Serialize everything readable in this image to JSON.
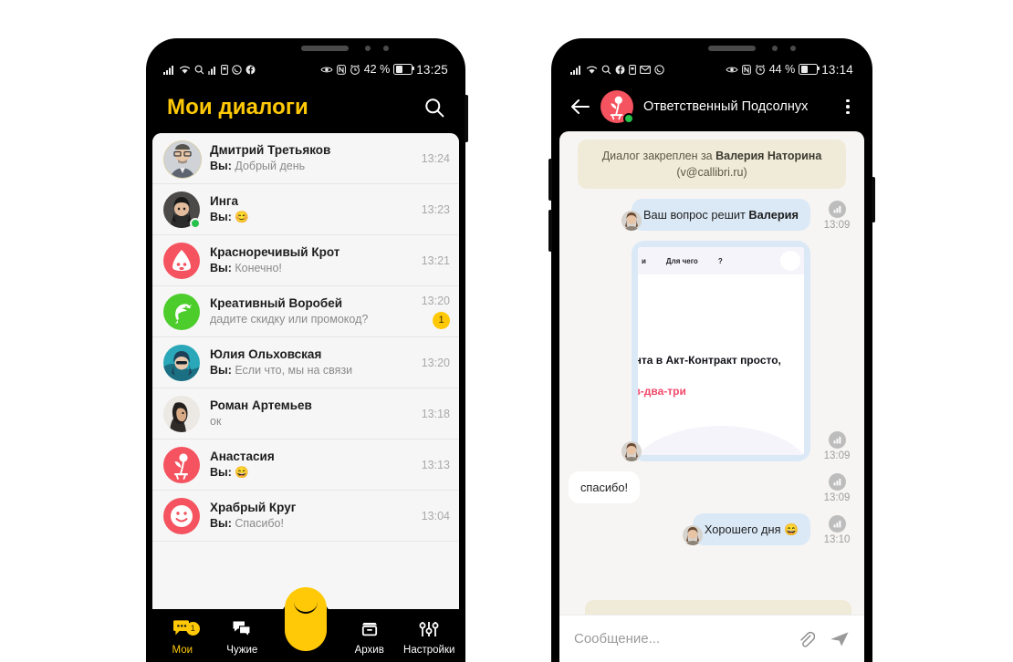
{
  "theme": {
    "accent_yellow": "#FFC907",
    "avatar_red": "#F4535F",
    "avatar_green": "#4CCD2B",
    "online_green": "#27C24C",
    "bubble_out": "#DBE9F7",
    "notice_bg": "#F0EBD8",
    "chat_bg": "#F6F5F3",
    "list_bg": "#F6F6F6"
  },
  "left_phone": {
    "status_bar": {
      "icons_left": [
        "signal-icon",
        "wifi-icon",
        "search-icon",
        "signal2-icon",
        "sim-icon",
        "whatsapp-icon",
        "facebook-icon"
      ],
      "icons_right": [
        "eye-icon",
        "nfc-icon",
        "alarm-icon"
      ],
      "battery_percent": "42 %",
      "time": "13:25"
    },
    "header": {
      "title": "Мои диалоги",
      "search_icon": "search-icon"
    },
    "dialogs": [
      {
        "name": "Дмитрий Третьяков",
        "prefix": "Вы:",
        "preview": "Добрый день",
        "time": "13:24",
        "avatar": "photo-man-glasses",
        "online": false,
        "unread": null
      },
      {
        "name": "Инга",
        "prefix": "Вы:",
        "preview": "😊",
        "time": "13:23",
        "avatar": "photo-woman-dark",
        "online": true,
        "unread": null
      },
      {
        "name": "Красноречивый Крот",
        "prefix": "Вы:",
        "preview": "Конечно!",
        "time": "13:21",
        "avatar": "mole-icon",
        "online": false,
        "unread": null
      },
      {
        "name": "Креативный Воробей",
        "prefix": "",
        "preview": "дадите скидку или промокод?",
        "time": "13:20",
        "avatar": "sparrow-icon",
        "online": false,
        "unread": "1"
      },
      {
        "name": "Юлия Ольховская",
        "prefix": "Вы:",
        "preview": "Если что, мы на связи",
        "time": "13:20",
        "avatar": "photo-woman-teal",
        "online": false,
        "unread": null
      },
      {
        "name": "Роман Артемьев",
        "prefix": "",
        "preview": "ок",
        "time": "13:18",
        "avatar": "photo-man-beard",
        "online": false,
        "unread": null
      },
      {
        "name": "Анастасия",
        "prefix": "Вы:",
        "preview": "😄",
        "time": "13:13",
        "avatar": "sunflower-icon",
        "online": false,
        "unread": null
      },
      {
        "name": "Храбрый Круг",
        "prefix": "Вы:",
        "preview": "Спасибо!",
        "time": "13:04",
        "avatar": "smiley-icon",
        "online": false,
        "unread": null
      }
    ],
    "bottom_nav": [
      {
        "label": "Мои",
        "icon": "chat-bubble-dots-icon",
        "active": true,
        "badge": "1"
      },
      {
        "label": "Чужие",
        "icon": "chat-bubbles-icon",
        "active": false,
        "badge": null
      },
      {
        "label": "Архив",
        "icon": "archive-box-icon",
        "active": false,
        "badge": null
      },
      {
        "label": "Настройки",
        "icon": "sliders-icon",
        "active": false,
        "badge": null
      }
    ],
    "fab": {
      "icon": "smile-capsule-icon"
    }
  },
  "right_phone": {
    "status_bar": {
      "icons_left": [
        "signal-icon",
        "wifi-icon",
        "search-icon",
        "facebook-icon",
        "sim-icon",
        "mail-icon",
        "whatsapp-icon"
      ],
      "icons_right": [
        "eye-icon",
        "nfc-icon",
        "alarm-icon"
      ],
      "battery_percent": "44 %",
      "time": "13:14"
    },
    "header": {
      "back_icon": "arrow-left-icon",
      "avatar": "sunflower-icon",
      "online": true,
      "title": "Ответственный Подсолнух",
      "menu_icon": "kebab-menu-icon"
    },
    "notice": {
      "text_before": "Диалог закреплен за ",
      "assignee": "Валерия Наторина",
      "text_after": "(v@callibri.ru)"
    },
    "messages": [
      {
        "type": "text",
        "direction": "out",
        "text_plain": "Ваш вопрос решит ",
        "text_bold": "Валерия",
        "time": "13:09",
        "status_icon": "delivered-bars-icon",
        "avatar": "operator-avatar"
      },
      {
        "type": "image",
        "direction": "out",
        "time": "13:09",
        "status_icon": "delivered-bars-icon",
        "avatar": "operator-avatar",
        "screenshot": {
          "nav_items": [
            "и",
            "Для чего",
            "?"
          ],
          "headline": "ента в Акт-Контракт просто,",
          "headline_accent": "аз-два-три"
        }
      },
      {
        "type": "text",
        "direction": "in",
        "text_plain": "спасибо!",
        "time": "13:09",
        "status_icon": "delivered-bars-icon"
      },
      {
        "type": "text",
        "direction": "out",
        "text_plain": "Хорошего дня 😄",
        "time": "13:10",
        "status_icon": "delivered-bars-icon",
        "avatar": "operator-avatar"
      }
    ],
    "composer": {
      "placeholder": "Сообщение...",
      "attach_icon": "paperclip-icon",
      "send_icon": "send-plane-icon"
    }
  }
}
